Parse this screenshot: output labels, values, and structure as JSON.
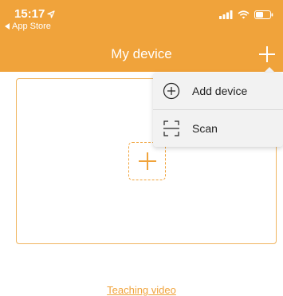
{
  "status": {
    "time": "15:17",
    "back_label": "App Store"
  },
  "nav": {
    "title": "My device"
  },
  "menu": {
    "items": [
      {
        "label": "Add device",
        "icon": "plus-circle-icon"
      },
      {
        "label": "Scan",
        "icon": "scan-icon"
      }
    ]
  },
  "footer": {
    "link_label": "Teaching video"
  },
  "colors": {
    "accent": "#F0A33B",
    "menu_bg": "#F2F2F2"
  }
}
